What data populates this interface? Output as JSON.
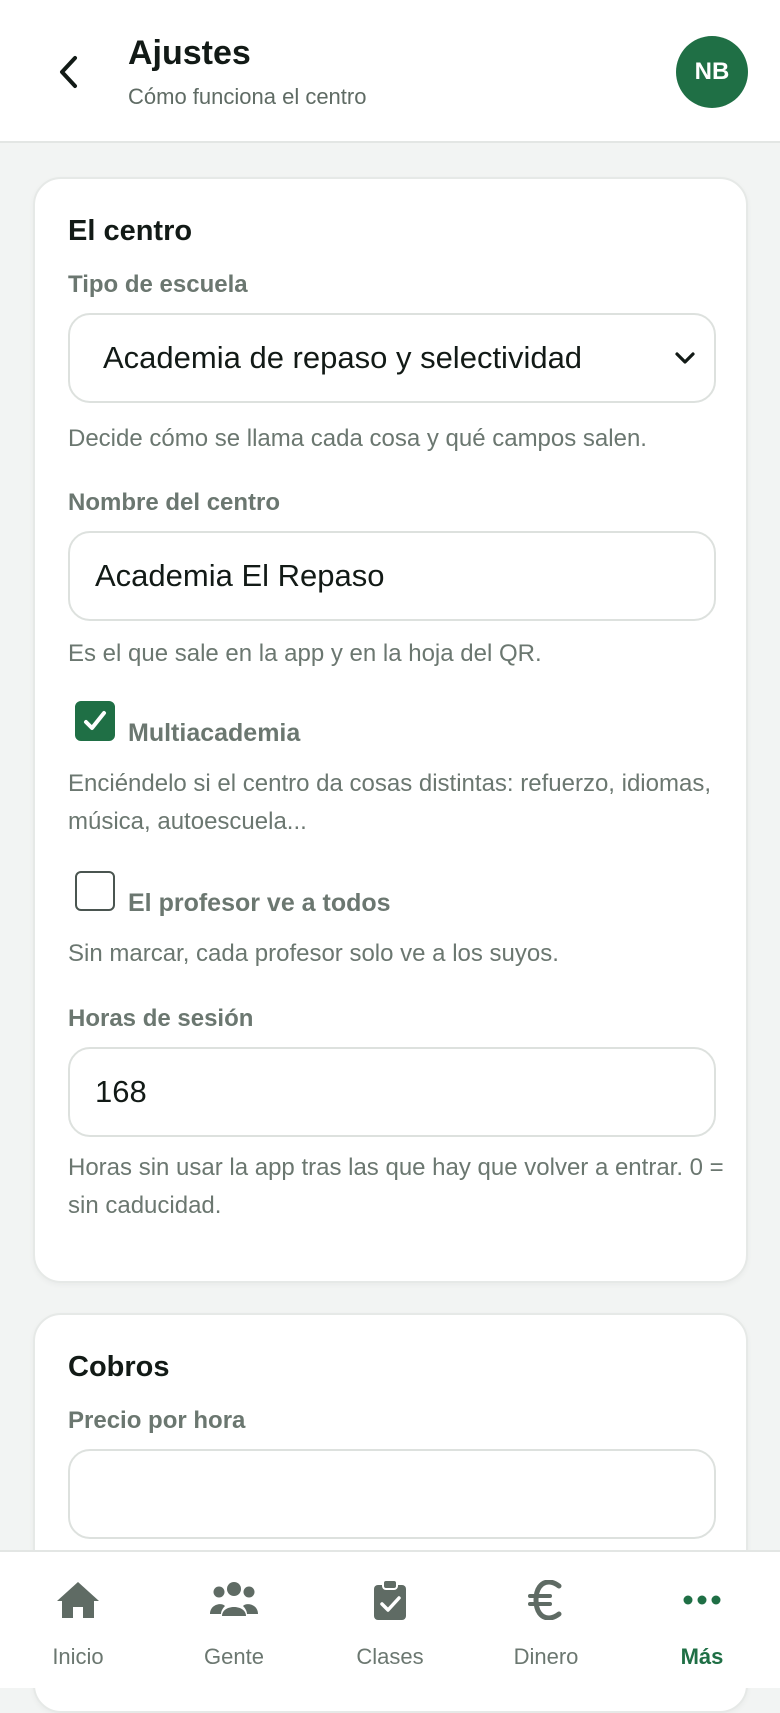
{
  "header": {
    "title": "Ajustes",
    "subtitle": "Cómo funciona el centro",
    "avatar_initials": "NB",
    "back_icon": "chevron-left-icon"
  },
  "centro": {
    "section_title": "El centro",
    "school_type": {
      "label": "Tipo de escuela",
      "value": "Academia de repaso y selectividad",
      "help": "Decide cómo se llama cada cosa y qué campos salen."
    },
    "center_name": {
      "label": "Nombre del centro",
      "value": "Academia El Repaso",
      "help": "Es el que sale en la app y en la hoja del QR."
    },
    "multiacademia": {
      "label": "Multiacademia",
      "checked": true,
      "help": "Enciéndelo si el centro da cosas distintas: refuerzo, idiomas, música, autoescuela..."
    },
    "teacher_sees_all": {
      "label": "El profesor ve a todos",
      "checked": false,
      "help": "Sin marcar, cada profesor solo ve a los suyos."
    },
    "session_hours": {
      "label": "Horas de sesión",
      "value": "168",
      "help": "Horas sin usar la app tras las que hay que volver a entrar. 0 = sin caducidad."
    }
  },
  "cobros": {
    "section_title": "Cobros",
    "price_per_hour": {
      "label": "Precio por hora",
      "value": ""
    }
  },
  "nav": {
    "items": [
      {
        "label": "Inicio",
        "icon": "home-icon"
      },
      {
        "label": "Gente",
        "icon": "people-icon"
      },
      {
        "label": "Clases",
        "icon": "clipboard-check-icon"
      },
      {
        "label": "Dinero",
        "icon": "euro-icon"
      },
      {
        "label": "Más",
        "icon": "more-dots-icon",
        "active": true
      }
    ]
  },
  "colors": {
    "accent": "#1f6f45",
    "muted_text": "#6b7770",
    "background": "#f2f4f3"
  }
}
